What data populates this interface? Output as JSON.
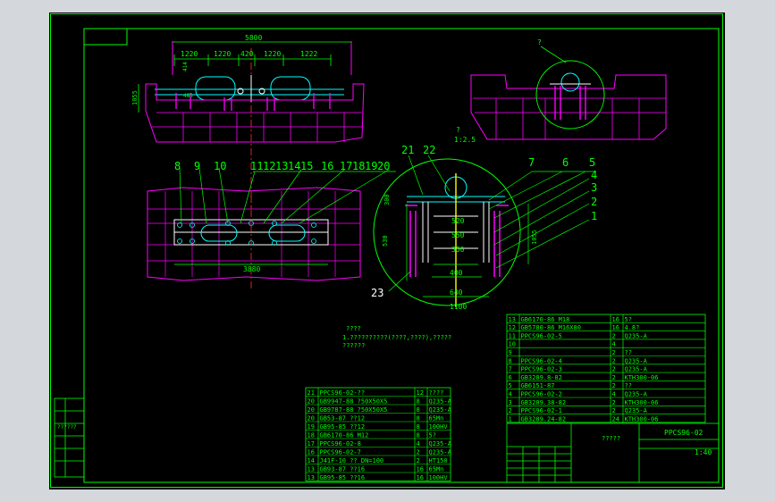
{
  "drawing": {
    "drawing_number": "PPCS96-02",
    "scale_text": "1:40",
    "title_placeholder": "?????",
    "note_title": "????",
    "note_line1": "1.??????????(????,????),?????",
    "note_line2": "??????",
    "detail_mark": "?",
    "detail_scale": "1:2.5",
    "left_side_text": "??????"
  },
  "front_view": {
    "overall_dim": "5800",
    "segment_dims": [
      "1220",
      "1220",
      "420",
      "1220",
      "1222"
    ],
    "height_dim": "1055",
    "small_dim_a": "414",
    "small_dim_b": "485"
  },
  "plan_view": {
    "balloons_top": [
      "8",
      "9",
      "10",
      "11",
      "12",
      "13",
      "14",
      "15",
      "16",
      "17",
      "18",
      "19",
      "20"
    ],
    "length_dim": "3880",
    "side_dim": "530"
  },
  "detail_view": {
    "balloons_left": [
      "21",
      "22",
      "23"
    ],
    "balloons_right": [
      "7",
      "6",
      "5",
      "4",
      "3",
      "2",
      "1"
    ],
    "dims": [
      "520",
      "550",
      "350",
      "400",
      "640",
      "1100"
    ],
    "side_dims": [
      "300",
      "1055"
    ]
  },
  "bom_right": [
    [
      "13",
      "GB6170-86 M18",
      "16",
      "5?"
    ],
    [
      "12",
      "GB5780-86 M16X80",
      "16",
      "4.8?"
    ],
    [
      "11",
      "PPCS96-02-5",
      "2",
      "Q235-A"
    ],
    [
      "10",
      "",
      "4",
      ""
    ],
    [
      "9",
      "",
      "2",
      "??"
    ],
    [
      "8",
      "PPCS96-02-4",
      "2",
      "Q235-A"
    ],
    [
      "7",
      "PPCS96-02-3",
      "2",
      "Q235-A"
    ],
    [
      "6",
      "GB3289.8-82",
      "2",
      "KTH300-06"
    ],
    [
      "5",
      "GB6151-87",
      "2",
      "??"
    ],
    [
      "4",
      "PPCS96-02-2",
      "4",
      "Q235-A"
    ],
    [
      "3",
      "GB3289.38-82",
      "2",
      "KTH300-06"
    ],
    [
      "2",
      "PPCS96-02-1",
      "2",
      "Q235-A"
    ],
    [
      "1",
      "GB3289.24-82",
      "24",
      "KTH300-06"
    ]
  ],
  "bom_left": [
    [
      "21",
      "PPCS96-02-??",
      "12",
      "????"
    ],
    [
      "20",
      "GB9947-88 ?50X50X5",
      "8",
      "Q235-A"
    ],
    [
      "20",
      "GB9787-88 ?50X50X5",
      "8",
      "Q235-A"
    ],
    [
      "20",
      "GB53-87 ??12",
      "8",
      "65Mn"
    ],
    [
      "19",
      "GB95-85 ??12",
      "8",
      "100HV"
    ],
    [
      "18",
      "GB6170-86 M12",
      "8",
      "5?"
    ],
    [
      "17",
      "PPCS96-02-8",
      "4",
      "Q235-A"
    ],
    [
      "16",
      "PPCS96-02-7",
      "2",
      "Q235-A"
    ],
    [
      "14",
      "J41F-10 ?? DN=100",
      "2",
      "HT150"
    ],
    [
      "13",
      "GB93-87 ??16",
      "16",
      "65Mn"
    ],
    [
      "13",
      "GB95-85 ??16",
      "16",
      "100HV"
    ]
  ],
  "colors": {
    "background": "#000000",
    "border": "#00ff00",
    "pink": "#ff00ff",
    "cyan": "#00ffff",
    "white": "#ffffff",
    "red": "#ff3030",
    "yellow": "#ffff00"
  }
}
